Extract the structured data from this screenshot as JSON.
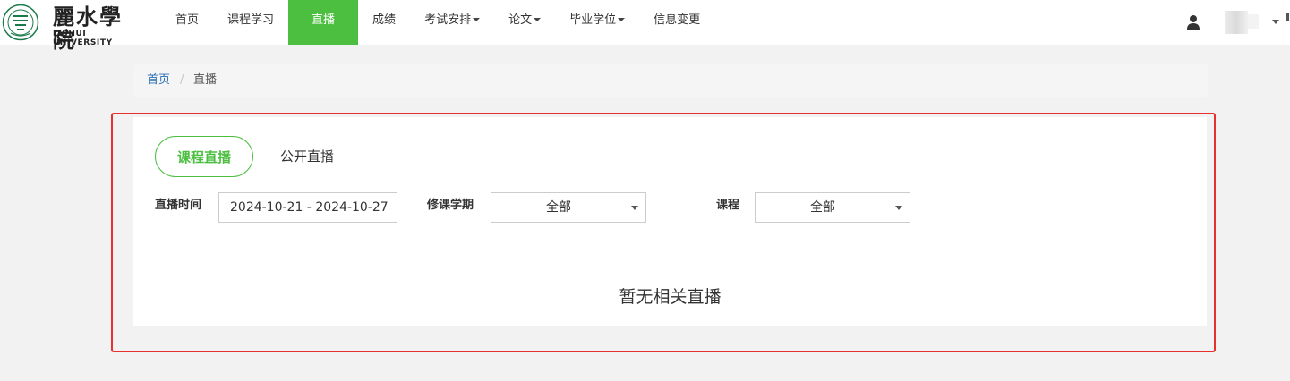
{
  "header": {
    "logo_cn": "麗水學院",
    "logo_en": "LISHUI UNIVERSITY",
    "emblem_icon": "university-emblem-icon",
    "nav": [
      {
        "label": "首页",
        "dropdown": false,
        "active": false
      },
      {
        "label": "课程学习",
        "dropdown": false,
        "active": false
      },
      {
        "label": "直播",
        "dropdown": false,
        "active": true
      },
      {
        "label": "成绩",
        "dropdown": false,
        "active": false
      },
      {
        "label": "考试安排",
        "dropdown": true,
        "active": false
      },
      {
        "label": "论文",
        "dropdown": true,
        "active": false
      },
      {
        "label": "毕业学位",
        "dropdown": true,
        "active": false
      },
      {
        "label": "信息变更",
        "dropdown": false,
        "active": false
      }
    ],
    "user_icon": "user-icon"
  },
  "breadcrumb": {
    "home": "首页",
    "separator": "/",
    "current": "直播"
  },
  "tabs": {
    "active": "课程直播",
    "other": "公开直播"
  },
  "filters": {
    "time_label": "直播时间",
    "time_value": "2024-10-21 - 2024-10-27",
    "term_label": "修课学期",
    "term_value": "全部",
    "course_label": "课程",
    "course_value": "全部"
  },
  "empty_message": "暂无相关直播",
  "colors": {
    "accent": "#4cbf41",
    "highlight_border": "#e8302f",
    "link": "#2b6fb3"
  }
}
